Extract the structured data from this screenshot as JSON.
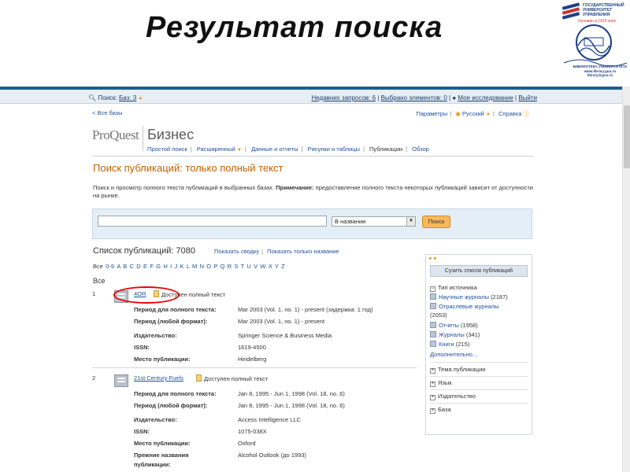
{
  "slide": {
    "title": "Результат поиска",
    "logo": {
      "text": "ГОСУДАРСТВЕННЫЙ УНИВЕРСИТЕТ УПРАВЛЕНИЯ",
      "motto": "Основан в 1919 году",
      "library": "БИБЛИОТЕКА УНИВЕРСИТЕТА www.library.guu.ru library@guu.ru"
    }
  },
  "topbar": {
    "search_label": "Поиск:",
    "bases_link": "Баз: 3",
    "recent": "Недавних запросов: 6",
    "selected": "Выбрано элементов: 0",
    "my_research": "Мое исследование",
    "logout": "Выйти"
  },
  "subbar": {
    "all_bases": "< Все базы",
    "settings": "Параметры",
    "language": "Русский",
    "help": "Справка"
  },
  "brand": {
    "logo": "ProQuest",
    "product": "Бизнес"
  },
  "nav": {
    "items": [
      "Простой поиск",
      "Расширенный",
      "Данные и отчеты",
      "Рисунки и таблицы",
      "Публикации",
      "Обзор"
    ]
  },
  "page": {
    "heading": "Поиск публикаций: только полный текст",
    "desc_main": "Поиск и просмотр полного текста публикаций в выбранных базах.",
    "desc_note_label": "Примечание:",
    "desc_note": "предоставление полного текста некоторых публикаций зависит от доступности на рынке."
  },
  "search": {
    "input_value": "",
    "field": "В названии",
    "button": "Поиск"
  },
  "list": {
    "title": "Список публикаций: 7080",
    "show_summary": "Показать сводку",
    "show_titles": "Показать только название",
    "alpha_all": "Все",
    "alpha": [
      "0-9",
      "A",
      "B",
      "C",
      "D",
      "E",
      "F",
      "G",
      "H",
      "I",
      "J",
      "K",
      "L",
      "M",
      "N",
      "O",
      "P",
      "Q",
      "R",
      "S",
      "T",
      "U",
      "V",
      "W",
      "X",
      "Y",
      "Z"
    ],
    "heading": "Все"
  },
  "results": [
    {
      "num": "1",
      "title": "4OR",
      "fulltext": "Доступен полный текст",
      "rows": [
        {
          "label": "Период для полного текста:",
          "value": "Mar 2003 (Vol. 1, no. 1) - present (задержка: 1 год)"
        },
        {
          "label": "Период (любой формат):",
          "value": "Mar 2003 (Vol. 1, no. 1) - present"
        },
        {
          "label": "Издательство:",
          "value": "Springer Science & Business Media"
        },
        {
          "label": "ISSN:",
          "value": "1619-4500"
        },
        {
          "label": "Место публикации:",
          "value": "Heidelberg"
        }
      ]
    },
    {
      "num": "2",
      "title": "21st Century Fuels",
      "fulltext": "Доступен полный текст",
      "rows": [
        {
          "label": "Период для полного текста:",
          "value": "Jan 8, 1995 - Jun 1, 1998 (Vol. 18, no. 6)"
        },
        {
          "label": "Период (любой формат):",
          "value": "Jan 8, 1995 - Jun 1, 1998 (Vol. 18, no. 6)"
        },
        {
          "label": "Издательство:",
          "value": "Access Intelligence LLC"
        },
        {
          "label": "ISSN:",
          "value": "1075-038X"
        },
        {
          "label": "Место публикации:",
          "value": "Oxford"
        },
        {
          "label": "Прежние названия",
          "label2": "публикации:",
          "value": "Alcohol Outlook (до 1993)"
        }
      ]
    }
  ],
  "facets": {
    "narrow": "Сузить список публикаций",
    "source_type": "Тип источника",
    "items": [
      {
        "label": "Научные журналы",
        "count": "(2187)"
      },
      {
        "label": "Отраслевые журналы",
        "count": "(2053)"
      },
      {
        "label": "Отчеты",
        "count": "(1958)"
      },
      {
        "label": "Журналы",
        "count": "(341)"
      },
      {
        "label": "Книги",
        "count": "(215)"
      }
    ],
    "more": "Дополнительно...",
    "groups": [
      "Тема публикации",
      "Язык",
      "Издательство",
      "База"
    ]
  }
}
